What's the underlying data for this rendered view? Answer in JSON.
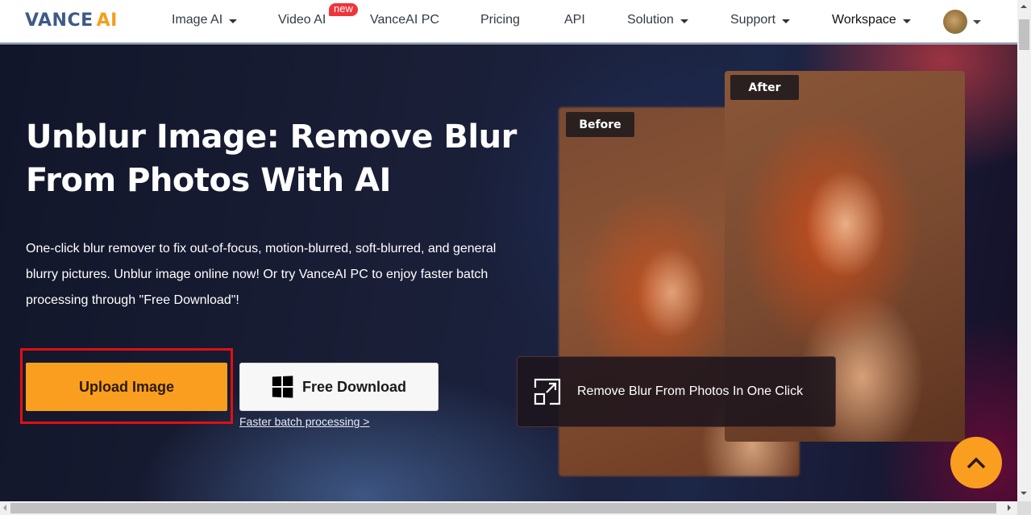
{
  "header": {
    "logo_main": "VANCE",
    "logo_accent": "AI",
    "nav": [
      {
        "label": "Image AI",
        "has_dropdown": true
      },
      {
        "label": "Video AI",
        "has_dropdown": false,
        "badge": "new"
      },
      {
        "label": "VanceAI PC",
        "has_dropdown": false
      },
      {
        "label": "Pricing",
        "has_dropdown": false
      },
      {
        "label": "API",
        "has_dropdown": false
      },
      {
        "label": "Solution",
        "has_dropdown": true
      },
      {
        "label": "Support",
        "has_dropdown": true
      },
      {
        "label": "Workspace",
        "has_dropdown": true
      }
    ],
    "avatar_icon": "user-avatar"
  },
  "hero": {
    "title": "Unblur Image: Remove Blur From Photos With AI",
    "description": "One-click blur remover to fix out-of-focus, motion-blurred, soft-blurred, and general blurry pictures. Unblur image online now! Or try VanceAI PC to enjoy faster batch processing through \"Free Download\"!",
    "upload_button": "Upload Image",
    "download_button": "Free Download",
    "download_icon": "windows-icon",
    "faster_link": "Faster batch processing >"
  },
  "showcase": {
    "before_label": "Before",
    "after_label": "After",
    "feature_icon": "expand-icon",
    "feature_text": "Remove Blur From Photos In One Click"
  },
  "colors": {
    "accent_orange": "#fa9e1f",
    "brand_blue": "#3e5a86",
    "badge_red": "#f0333a",
    "highlight_red": "#e01010"
  },
  "back_to_top_icon": "chevron-up-icon"
}
